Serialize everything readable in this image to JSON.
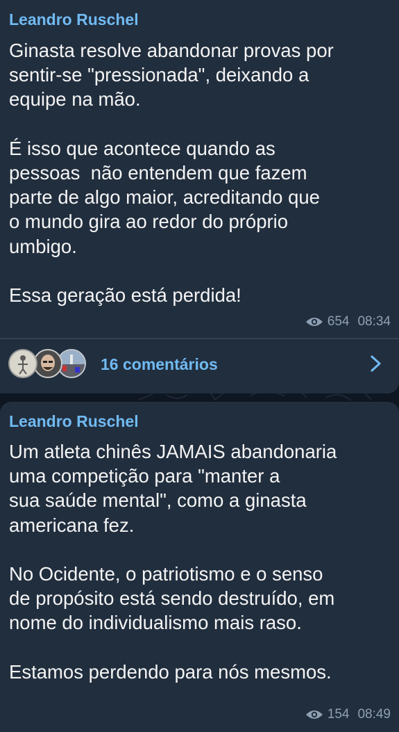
{
  "posts": [
    {
      "author": "Leandro Ruschel",
      "text": "Ginasta resolve abandonar provas por\nsentir-se \"pressionada\", deixando a\nequipe na mão.\n\nÉ isso que acontece quando as\npessoas  não entendem que fazem\nparte de algo maior, acreditando que\no mundo gira ao redor do próprio\numbigo.\n\nEssa geração está perdida!",
      "views": "654",
      "time": "08:34",
      "comments_label": "16 comentários",
      "view_icon": "eye-icon",
      "comments_icon": "chevron-right-icon"
    },
    {
      "author": "Leandro Ruschel",
      "text": "Um atleta chinês JAMAIS abandonaria\numa competição para \"manter a\nsua saúde mental\", como a ginasta\namericana fez.\n\nNo Ocidente, o patriotismo e o senso\nde propósito está sendo destruído, em\nnome do individualismo mais raso.\n\nEstamos perdendo para nós mesmos.",
      "views": "154",
      "time": "08:49",
      "view_icon": "eye-icon"
    }
  ],
  "colors": {
    "background": "#0e1621",
    "bubble": "#212e3e",
    "author": "#71baf2",
    "text": "#f4f4f4",
    "meta": "#8ea0b3",
    "link": "#71baf2"
  }
}
